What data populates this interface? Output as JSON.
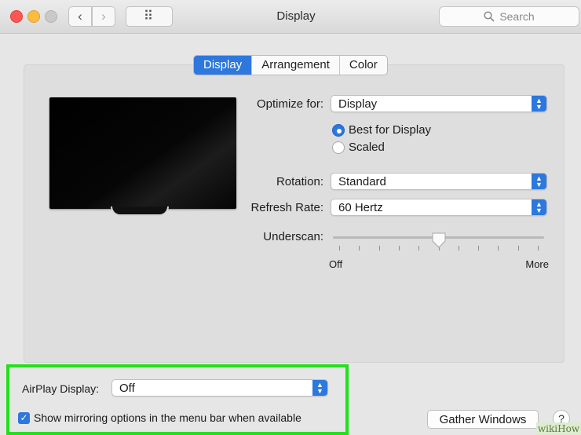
{
  "window": {
    "title": "Display"
  },
  "search": {
    "placeholder": "Search"
  },
  "toolbar": {
    "back_glyph": "‹",
    "forward_glyph": "›",
    "grid_glyph": "⠿"
  },
  "tabs": [
    {
      "label": "Display",
      "active": true
    },
    {
      "label": "Arrangement",
      "active": false
    },
    {
      "label": "Color",
      "active": false
    }
  ],
  "optimize": {
    "label": "Optimize for:",
    "value": "Display",
    "options": [
      {
        "label": "Best for Display",
        "selected": true
      },
      {
        "label": "Scaled",
        "selected": false
      }
    ]
  },
  "rotation": {
    "label": "Rotation:",
    "value": "Standard"
  },
  "refresh": {
    "label": "Refresh Rate:",
    "value": "60 Hertz"
  },
  "underscan": {
    "label": "Underscan:",
    "min_label": "Off",
    "max_label": "More",
    "value_fraction": 0.5,
    "tick_count": 11
  },
  "airplay": {
    "label": "AirPlay Display:",
    "value": "Off"
  },
  "mirroring": {
    "label": "Show mirroring options in the menu bar when available",
    "checked": true
  },
  "buttons": {
    "gather": "Gather Windows",
    "help": "?"
  },
  "watermark": "wikiHow",
  "colors": {
    "accent": "#2d77dd",
    "highlight": "#22e01b",
    "close": "#fc5753",
    "minimize": "#fdbc40",
    "zoom": "#c9c9c9"
  }
}
